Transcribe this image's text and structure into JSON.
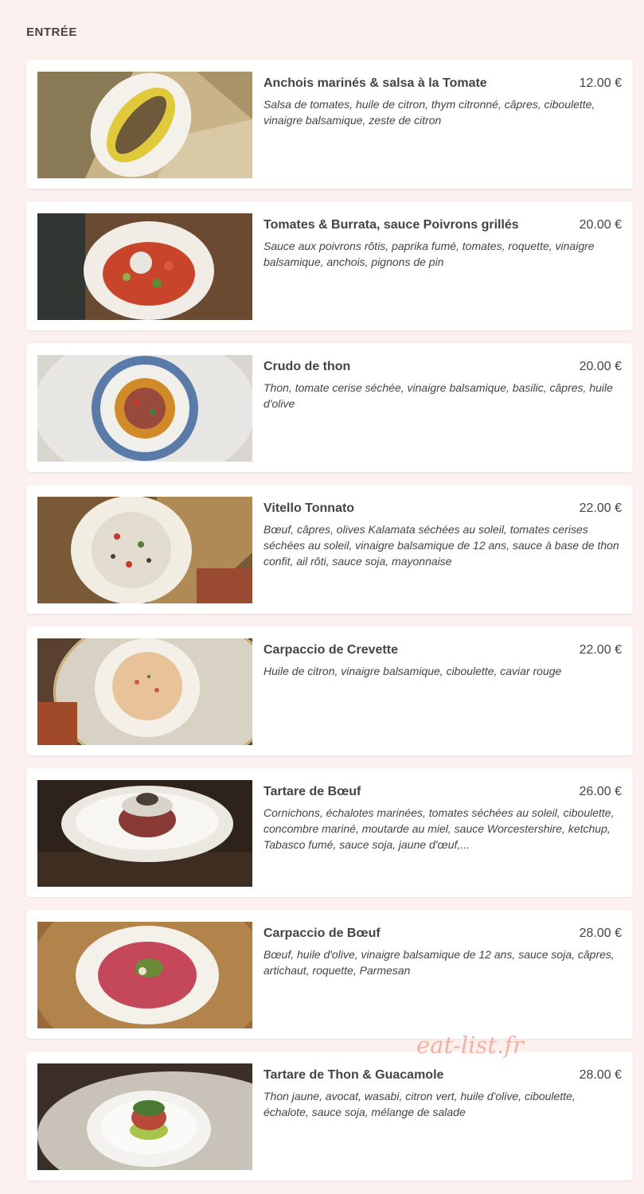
{
  "section": {
    "title": "ENTRÉE"
  },
  "items": [
    {
      "name": "Anchois marinés & salsa à la Tomate",
      "price": "12.00 €",
      "description": "Salsa de tomates, huile de citron, thym citronné, câpres, ciboulette, vinaigre balsamique, zeste de citron"
    },
    {
      "name": "Tomates & Burrata, sauce Poivrons grillés",
      "price": "20.00 €",
      "description": "Sauce aux poivrons rôtis, paprika fumé, tomates, roquette, vinaigre balsamique, anchois, pignons de pin"
    },
    {
      "name": "Crudo de thon",
      "price": "20.00 €",
      "description": "Thon, tomate cerise séchée, vinaigre balsamique, basilic, câpres, huile d'olive"
    },
    {
      "name": "Vitello Tonnato",
      "price": "22.00 €",
      "description": "Bœuf, câpres, olives Kalamata séchées au soleil, tomates cerises séchées au soleil, vinaigre balsamique de 12 ans, sauce à base de thon confit, ail rôti, sauce soja, mayonnaise"
    },
    {
      "name": "Carpaccio de Crevette",
      "price": "22.00 €",
      "description": "Huile de citron, vinaigre balsamique, ciboulette, caviar rouge"
    },
    {
      "name": "Tartare de Bœuf",
      "price": "26.00 €",
      "description": "Cornichons, échalotes marinées, tomates séchées au soleil, ciboulette, concombre mariné, moutarde au miel, sauce Worcestershire, ketchup, Tabasco fumé, sauce soja, jaune d'œuf,..."
    },
    {
      "name": "Carpaccio de Bœuf",
      "price": "28.00 €",
      "description": "Bœuf, huile d'olive, vinaigre balsamique de 12 ans, sauce soja, câpres, artichaut, roquette, Parmesan"
    },
    {
      "name": "Tartare de Thon & Guacamole",
      "price": "28.00 €",
      "description": "Thon jaune, avocat, wasabi, citron vert, huile d'olive, ciboulette, échalote, sauce soja, mélange de salade"
    }
  ],
  "watermark": "eat-list.fr",
  "colors": {
    "background": "#fdf1f0",
    "card": "#ffffff",
    "text": "#444444",
    "watermark": "#f1a896"
  }
}
